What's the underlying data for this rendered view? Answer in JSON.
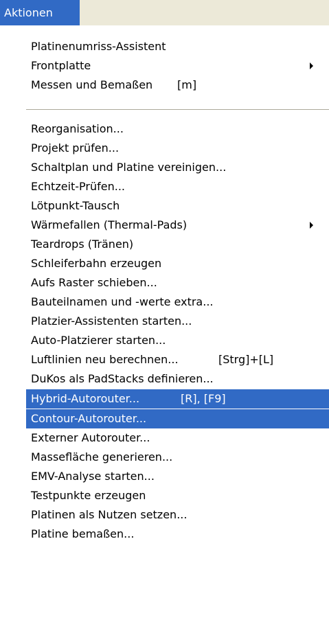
{
  "menubar": {
    "title": "Aktionen"
  },
  "menu": {
    "group1": [
      {
        "label": "Platinenumriss-Assistent",
        "shortcut": "",
        "submenu": false
      },
      {
        "label": "Frontplatte",
        "shortcut": "",
        "submenu": true
      },
      {
        "label": "Messen und Bemaßen",
        "shortcut": "[m]",
        "submenu": false
      }
    ],
    "group2": [
      {
        "label": "Reorganisation...",
        "shortcut": "",
        "submenu": false
      },
      {
        "label": "Projekt prüfen...",
        "shortcut": "",
        "submenu": false
      },
      {
        "label": "Schaltplan und Platine vereinigen...",
        "shortcut": "",
        "submenu": false
      },
      {
        "label": "Echtzeit-Prüfen...",
        "shortcut": "",
        "submenu": false
      },
      {
        "label": "Lötpunkt-Tausch",
        "shortcut": "",
        "submenu": false
      },
      {
        "label": "Wärmefallen (Thermal-Pads)",
        "shortcut": "",
        "submenu": true
      },
      {
        "label": "Teardrops (Tränen)",
        "shortcut": "",
        "submenu": false
      },
      {
        "label": "Schleiferbahn erzeugen",
        "shortcut": "",
        "submenu": false
      },
      {
        "label": "Aufs Raster schieben...",
        "shortcut": "",
        "submenu": false
      },
      {
        "label": "Bauteilnamen und -werte extra...",
        "shortcut": "",
        "submenu": false
      },
      {
        "label": "Platzier-Assistenten starten...",
        "shortcut": "",
        "submenu": false
      },
      {
        "label": "Auto-Platzierer starten...",
        "shortcut": "",
        "submenu": false
      },
      {
        "label": "Luftlinien neu berechnen...",
        "shortcut": "[Strg]+[L]",
        "submenu": false
      },
      {
        "label": "DuKos als PadStacks definieren...",
        "shortcut": "",
        "submenu": false
      },
      {
        "label": "Hybrid-Autorouter...",
        "shortcut": "[R], [F9]",
        "submenu": false,
        "highlighted": true
      },
      {
        "label": "Contour-Autorouter...",
        "shortcut": "",
        "submenu": false,
        "highlighted": true
      },
      {
        "label": "Externer Autorouter...",
        "shortcut": "",
        "submenu": false
      },
      {
        "label": "Massefläche generieren...",
        "shortcut": "",
        "submenu": false
      },
      {
        "label": "EMV-Analyse starten...",
        "shortcut": "",
        "submenu": false
      },
      {
        "label": "Testpunkte erzeugen",
        "shortcut": "",
        "submenu": false
      },
      {
        "label": "Platinen als Nutzen setzen...",
        "shortcut": "",
        "submenu": false
      },
      {
        "label": "Platine bemaßen...",
        "shortcut": "",
        "submenu": false
      }
    ]
  },
  "colors": {
    "highlight": "#316ac5",
    "menubar_bg": "#ece9d8"
  }
}
